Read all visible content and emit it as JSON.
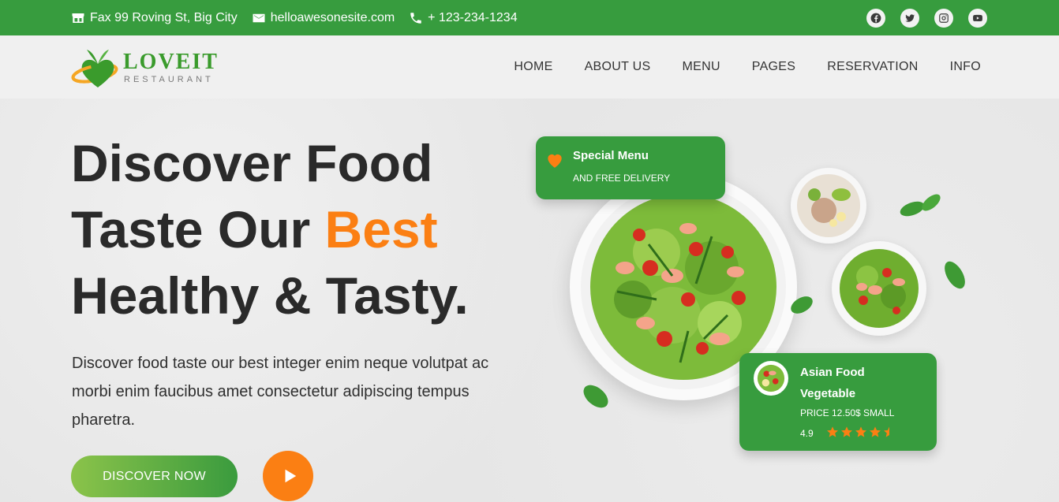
{
  "topbar": {
    "address": "Fax 99 Roving St, Big City",
    "email": "helloawesonesite.com",
    "phone": "+ 123-234-1234",
    "socials": [
      "facebook-icon",
      "twitter-icon",
      "instagram-icon",
      "youtube-icon"
    ]
  },
  "brand": {
    "name": "LOVEIT",
    "tagline": "RESTAURANT"
  },
  "nav": {
    "items": [
      "HOME",
      "ABOUT US",
      "MENU",
      "PAGES",
      "RESERVATION",
      "INFO"
    ]
  },
  "hero": {
    "line1": "Discover Food",
    "line2_prefix": "Taste Our ",
    "line2_accent": "Best",
    "line3": "Healthy & Tasty.",
    "description": "Discover food taste our best integer enim neque volutpat ac morbi enim faucibus amet consectetur adipiscing tempus pharetra.",
    "cta_label": "DISCOVER NOW"
  },
  "special_card": {
    "title": "Special Menu",
    "subtitle": "AND FREE DELIVERY"
  },
  "food_card": {
    "name": "Asian Food Vegetable",
    "price": "PRICE 12.50$ SMALL",
    "rating": "4.9",
    "stars": 4.5
  },
  "colors": {
    "green": "#379c3e",
    "orange": "#fb7f13",
    "text_dark": "#2a2a2a"
  }
}
